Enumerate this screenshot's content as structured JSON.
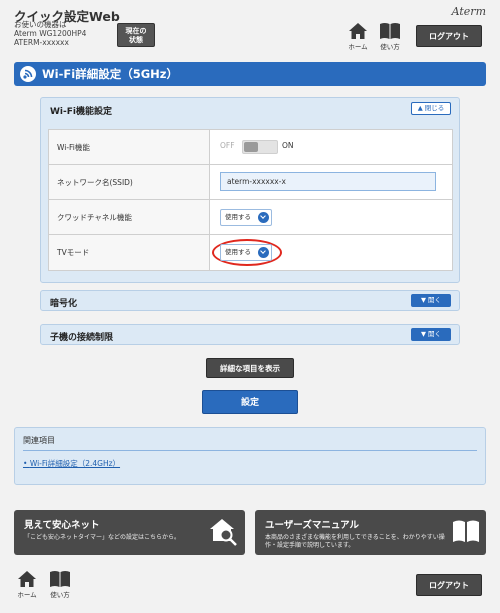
{
  "header": {
    "app_title": "クイック設定Web",
    "device_lines": [
      "お使いの機器は",
      "Aterm WG1200HP4",
      "ATERM-xxxxxx"
    ],
    "status_button": [
      "現在の",
      "状態"
    ],
    "brand": "Aterm",
    "home_label": "ホーム",
    "manual_label": "使い方",
    "logout_label": "ログアウト"
  },
  "page": {
    "title": "Wi-Fi詳細設定（5GHz）"
  },
  "wifi_function": {
    "title": "Wi-Fi機能設定",
    "close_label": "閉じる",
    "rows": {
      "wifi": {
        "label": "Wi-Fi機能",
        "off": "OFF",
        "on": "ON"
      },
      "ssid": {
        "label": "ネットワーク名(SSID)",
        "value": "aterm-xxxxxx-x"
      },
      "quad": {
        "label": "クワッドチャネル機能",
        "value": "使用する"
      },
      "tv": {
        "label": "TVモード",
        "value": "使用する"
      }
    }
  },
  "encryption": {
    "title": "暗号化",
    "open_label": "開く"
  },
  "client_limit": {
    "title": "子機の接続制限",
    "open_label": "開く"
  },
  "buttons": {
    "detail": "詳細な項目を表示",
    "apply": "設定"
  },
  "related": {
    "title": "関連項目",
    "link": "Wi-Fi詳細設定（2.4GHz）"
  },
  "promo_left": {
    "title": "見えて安心ネット",
    "desc": "「こども安心ネットタイマー」などの設定はこちらから。"
  },
  "promo_right": {
    "title": "ユーザーズマニュアル",
    "desc": "本商品のさまざまな機能を利用してできることを、わかりやすい操作・設定手順で説明しています。"
  },
  "footer": {
    "home_label": "ホーム",
    "manual_label": "使い方",
    "logout_label": "ログアウト"
  },
  "colors": {
    "accent": "#2a6bbd",
    "panel": "#dce9f5",
    "dark_button": "#4a4a4a",
    "highlight_ring": "#e0281e"
  }
}
